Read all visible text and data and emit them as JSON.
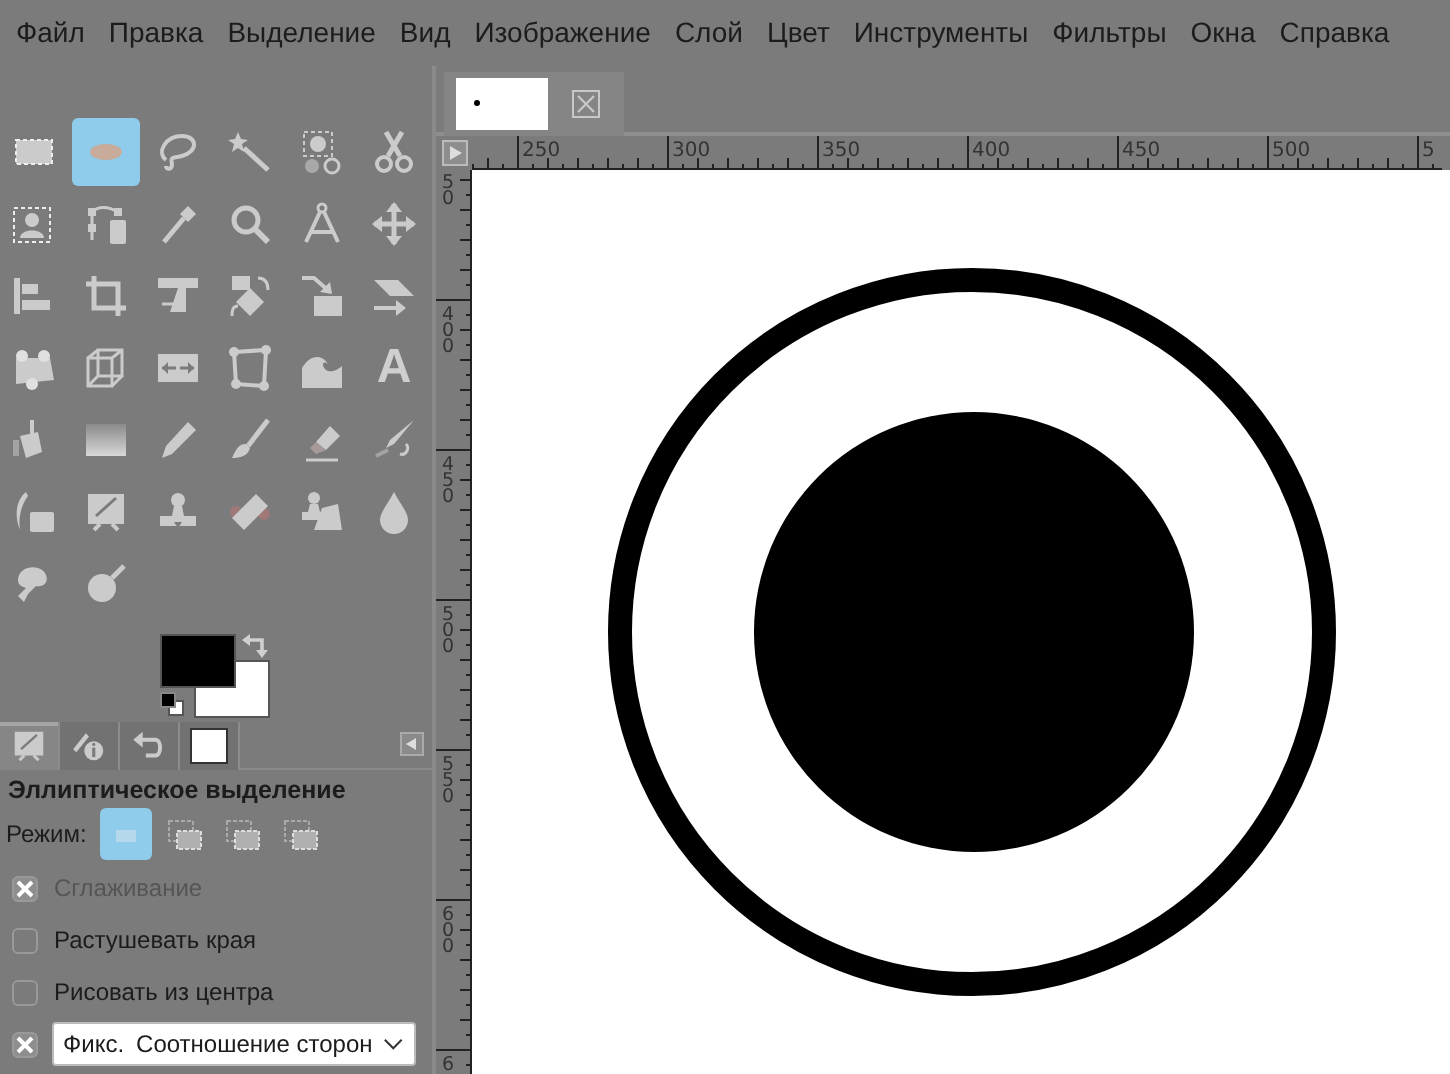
{
  "menu": [
    "Файл",
    "Правка",
    "Выделение",
    "Вид",
    "Изображение",
    "Слой",
    "Цвет",
    "Инструменты",
    "Фильтры",
    "Окна",
    "Справка"
  ],
  "toolbox": {
    "tools": [
      {
        "kind": "rect-select",
        "selected": false
      },
      {
        "kind": "ellipse-select",
        "selected": true
      },
      {
        "kind": "lasso",
        "selected": false
      },
      {
        "kind": "wand",
        "selected": false
      },
      {
        "kind": "color-select",
        "selected": false
      },
      {
        "kind": "scissors",
        "selected": false
      },
      {
        "kind": "foreground-select",
        "selected": false
      },
      {
        "kind": "paths",
        "selected": false
      },
      {
        "kind": "picker",
        "selected": false
      },
      {
        "kind": "zoom",
        "selected": false
      },
      {
        "kind": "measure",
        "selected": false
      },
      {
        "kind": "move",
        "selected": false
      },
      {
        "kind": "align",
        "selected": false
      },
      {
        "kind": "crop",
        "selected": false
      },
      {
        "kind": "unified",
        "selected": false
      },
      {
        "kind": "rotate",
        "selected": false
      },
      {
        "kind": "scale",
        "selected": false
      },
      {
        "kind": "shear",
        "selected": false
      },
      {
        "kind": "handle",
        "selected": false
      },
      {
        "kind": "cube",
        "selected": false
      },
      {
        "kind": "flip",
        "selected": false
      },
      {
        "kind": "cage",
        "selected": false
      },
      {
        "kind": "wave",
        "selected": false
      },
      {
        "kind": "text",
        "glyph": "A",
        "selected": false
      },
      {
        "kind": "bucket",
        "selected": false
      },
      {
        "kind": "gradient",
        "selected": false
      },
      {
        "kind": "pencil",
        "selected": false
      },
      {
        "kind": "brush",
        "selected": false
      },
      {
        "kind": "eraser",
        "selected": false
      },
      {
        "kind": "nib",
        "selected": false
      },
      {
        "kind": "ink",
        "selected": false
      },
      {
        "kind": "easel",
        "selected": false
      },
      {
        "kind": "stamp",
        "selected": false
      },
      {
        "kind": "bandage",
        "selected": false
      },
      {
        "kind": "stamp-box",
        "selected": false
      },
      {
        "kind": "drop",
        "selected": false
      },
      {
        "kind": "smudge",
        "selected": false
      },
      {
        "kind": "pan",
        "selected": false
      }
    ]
  },
  "dock_tabs": [
    {
      "kind": "easel",
      "selected": true
    },
    {
      "kind": "info",
      "selected": false
    },
    {
      "kind": "undo",
      "selected": false
    },
    {
      "kind": "thumb",
      "selected": false
    }
  ],
  "tool_options": {
    "title": "Эллиптическое выделение",
    "mode_label": "Режим:",
    "modes": [
      {
        "selected": true
      },
      {
        "selected": false
      },
      {
        "selected": false
      },
      {
        "selected": false
      }
    ],
    "checkboxes": [
      {
        "label": "Сглаживание",
        "checked": true,
        "disabled": true
      },
      {
        "label": "Растушевать края",
        "checked": false,
        "disabled": false
      },
      {
        "label": "Рисовать из центра",
        "checked": false,
        "disabled": false
      }
    ],
    "fixed": {
      "label": "Фикс.",
      "checked": true,
      "value": "Соотношение сторон"
    }
  },
  "horizontal_ruler": {
    "labels": [
      "250",
      "300",
      "350",
      "400",
      "450",
      "500",
      "5"
    ]
  },
  "vertical_ruler": {
    "labels": [
      "50",
      "400",
      "450",
      "500",
      "550",
      "600",
      "6"
    ]
  }
}
